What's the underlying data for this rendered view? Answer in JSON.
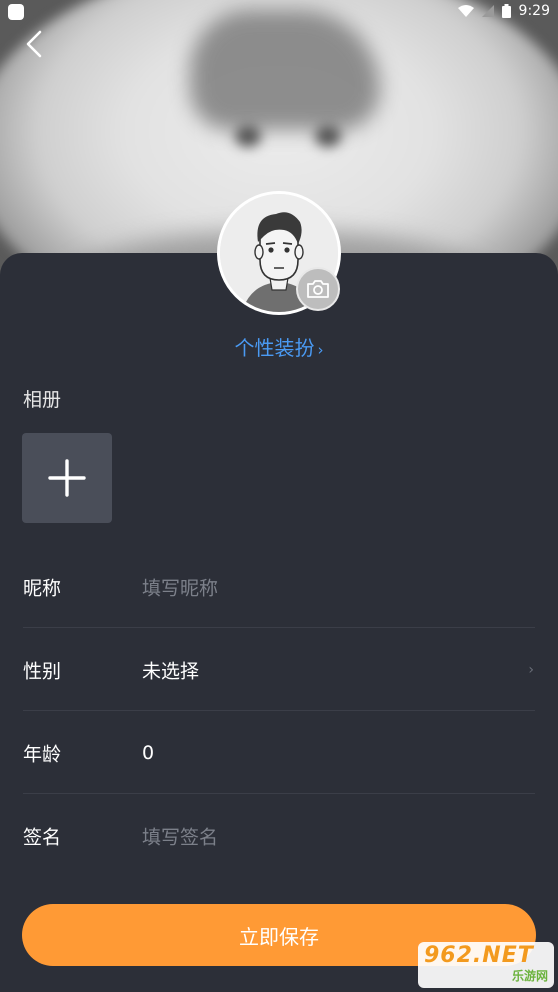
{
  "status_bar": {
    "time": "9:29"
  },
  "header": {
    "back_icon": "chevron-left-icon",
    "avatar_icon": "avatar-illustration",
    "camera_icon": "camera-icon",
    "personalize_label": "个性装扮",
    "personalize_chevron": "›"
  },
  "album": {
    "label": "相册",
    "add_icon": "plus-icon"
  },
  "form": {
    "nickname": {
      "label": "昵称",
      "placeholder": "填写昵称"
    },
    "gender": {
      "label": "性别",
      "value": "未选择",
      "arrow": "›"
    },
    "age": {
      "label": "年龄",
      "value": "0"
    },
    "signature": {
      "label": "签名",
      "placeholder": "填写签名"
    }
  },
  "actions": {
    "save_label": "立即保存"
  },
  "watermark": {
    "top": "962.NET",
    "bottom": "乐游网"
  },
  "colors": {
    "background": "#2c2f38",
    "accent_link": "#4a9af3",
    "save_button": "#ff9a35",
    "add_tile": "#4a4e59"
  }
}
